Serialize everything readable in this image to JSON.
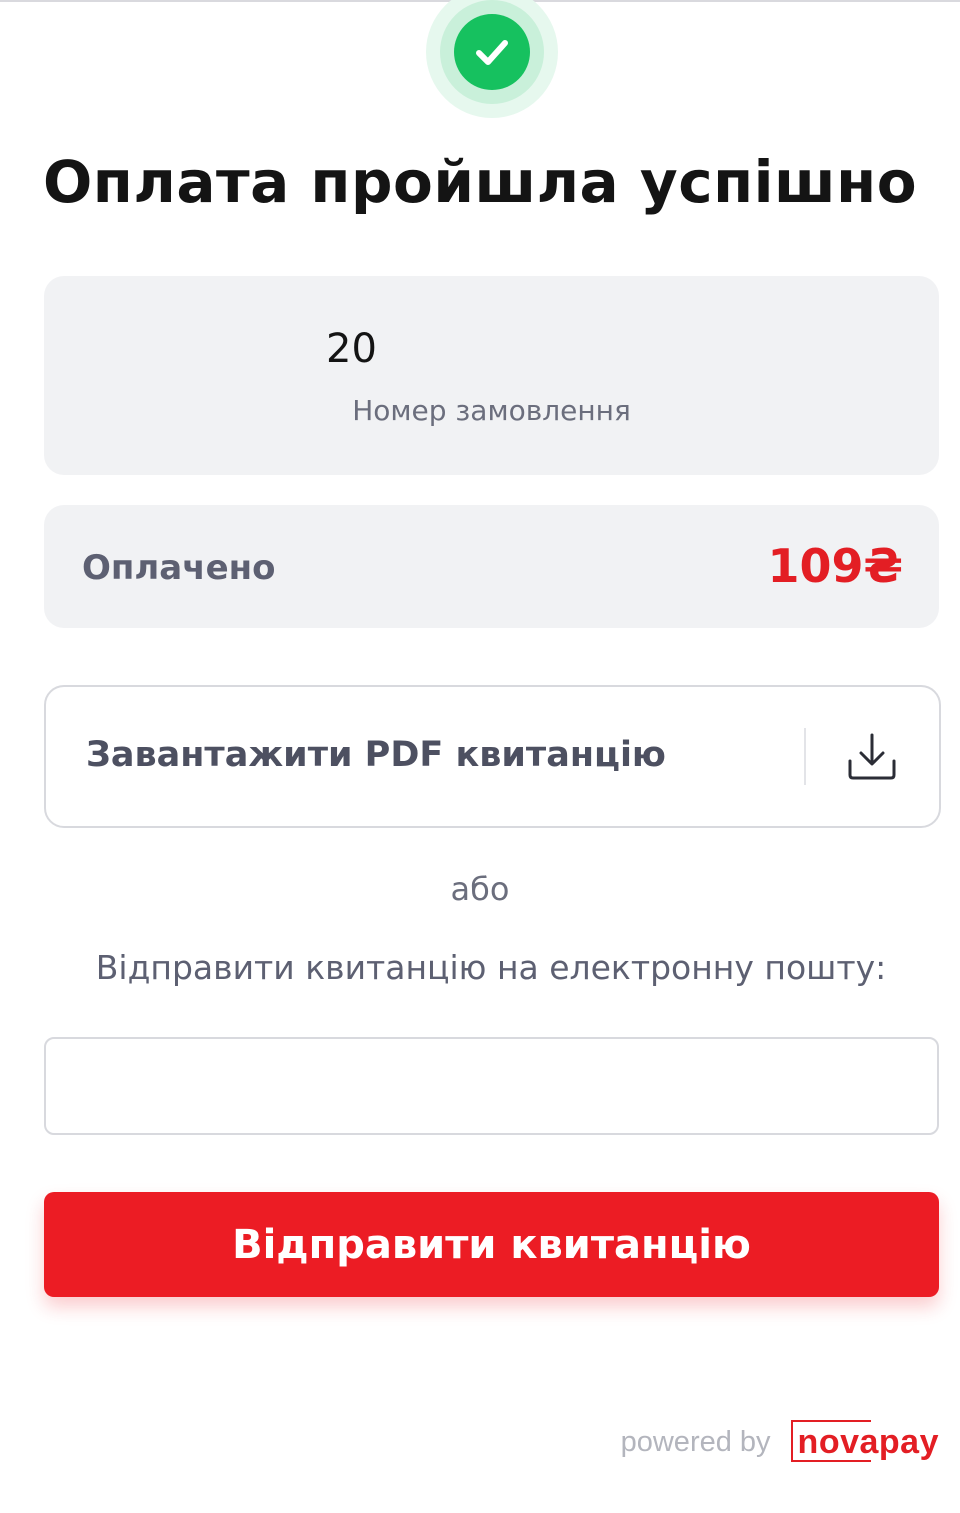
{
  "header": {
    "title": "Оплата пройшла успішно",
    "status_icon": "check-circle-icon"
  },
  "order": {
    "number": "20",
    "label": "Номер замовлення"
  },
  "payment": {
    "label": "Оплачено",
    "amount": "109₴"
  },
  "download": {
    "label": "Завантажити PDF квитанцію",
    "icon": "download-icon"
  },
  "alternative": {
    "or_text": "або",
    "email_prompt": "Відправити квитанцію на електронну пошту:"
  },
  "email_input": {
    "value": "",
    "placeholder": ""
  },
  "send_button": {
    "label": "Відправити квитанцію"
  },
  "footer": {
    "powered_by": "powered by",
    "brand": "novapay"
  },
  "colors": {
    "accent_red": "#ec1c24",
    "success_green": "#16c15f",
    "card_bg": "#f1f2f4",
    "muted_text": "#6b6e7d"
  }
}
